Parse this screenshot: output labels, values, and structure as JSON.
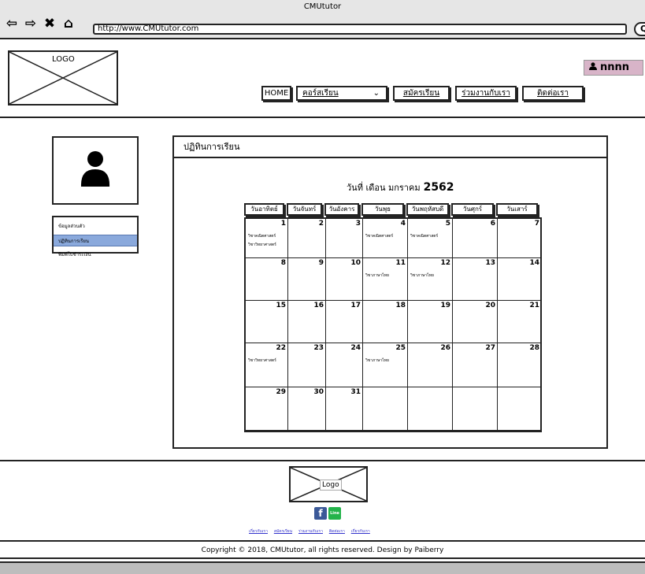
{
  "browser": {
    "window_title": "CMUtutor",
    "url": "http://www.CMUtutor.com"
  },
  "header": {
    "logo_label": "LOGO",
    "user_name": "nnnn",
    "menu": {
      "home": "HOME",
      "courses": "คอร์สเรียน",
      "register": "สมัครเรียน",
      "partner": "ร่วมงานกับเรา",
      "contact": "ติดต่อเรา"
    }
  },
  "sidebar": {
    "items": [
      {
        "label": "ข้อมูลส่วนตัว",
        "active": false
      },
      {
        "label": "ปฏิทินการเรียน",
        "active": true
      },
      {
        "label": "พิมพ์ใบชำระเงิน",
        "active": false
      }
    ]
  },
  "panel": {
    "title": "ปฏิทินการเรียน",
    "heading_prefix": "วันที่ เดือน มกราคม",
    "heading_year": "2562"
  },
  "calendar": {
    "weekdays": [
      "วันอาทิตย์",
      "วันจันทร์",
      "วันอังคาร",
      "วันพุธ",
      "วันพฤหัสบดี",
      "วันศุกร์",
      "วันเสาร์"
    ],
    "weeks": [
      [
        {
          "d": "1",
          "ev": [
            "วิชาคณิตศาสตร์",
            "วิชาวิทยาศาสตร์"
          ]
        },
        {
          "d": "2",
          "ev": []
        },
        {
          "d": "3",
          "ev": []
        },
        {
          "d": "4",
          "ev": [
            "วิชาคณิตศาสตร์"
          ]
        },
        {
          "d": "5",
          "ev": [
            "วิชาคณิตศาสตร์"
          ]
        },
        {
          "d": "6",
          "ev": []
        },
        {
          "d": "7",
          "ev": []
        }
      ],
      [
        {
          "d": "8",
          "ev": []
        },
        {
          "d": "9",
          "ev": []
        },
        {
          "d": "10",
          "ev": []
        },
        {
          "d": "11",
          "ev": [
            "วิชาภาษาไทย"
          ]
        },
        {
          "d": "12",
          "ev": [
            "วิชาภาษาไทย"
          ]
        },
        {
          "d": "13",
          "ev": []
        },
        {
          "d": "14",
          "ev": []
        }
      ],
      [
        {
          "d": "15",
          "ev": []
        },
        {
          "d": "16",
          "ev": []
        },
        {
          "d": "17",
          "ev": []
        },
        {
          "d": "18",
          "ev": []
        },
        {
          "d": "19",
          "ev": []
        },
        {
          "d": "20",
          "ev": []
        },
        {
          "d": "21",
          "ev": []
        }
      ],
      [
        {
          "d": "22",
          "ev": [
            "วิชาวิทยาศาสตร์"
          ]
        },
        {
          "d": "23",
          "ev": []
        },
        {
          "d": "24",
          "ev": []
        },
        {
          "d": "25",
          "ev": [
            "วิชาภาษาไทย"
          ]
        },
        {
          "d": "26",
          "ev": []
        },
        {
          "d": "27",
          "ev": []
        },
        {
          "d": "28",
          "ev": []
        }
      ],
      [
        {
          "d": "29",
          "ev": []
        },
        {
          "d": "30",
          "ev": []
        },
        {
          "d": "31",
          "ev": []
        },
        {
          "d": "",
          "ev": []
        },
        {
          "d": "",
          "ev": []
        },
        {
          "d": "",
          "ev": []
        },
        {
          "d": "",
          "ev": []
        }
      ]
    ]
  },
  "footer": {
    "logo_label": "Logo",
    "facebook_icon": "f",
    "line_icon": "Line",
    "links": [
      "เกี่ยวกับเรา",
      "สมัครเรียน",
      "ร่วมงานกับเรา",
      "ติดต่อเรา",
      "เกี่ยวกับเรา"
    ],
    "copyright": "Copyright © 2018, CMUtutor, all rights reserved. Design by Paiberry"
  },
  "colors": {
    "user_button": "#d8b4c8",
    "active_sidebar": "#8aa9dc",
    "facebook": "#3b5998",
    "line": "#23b34a"
  }
}
